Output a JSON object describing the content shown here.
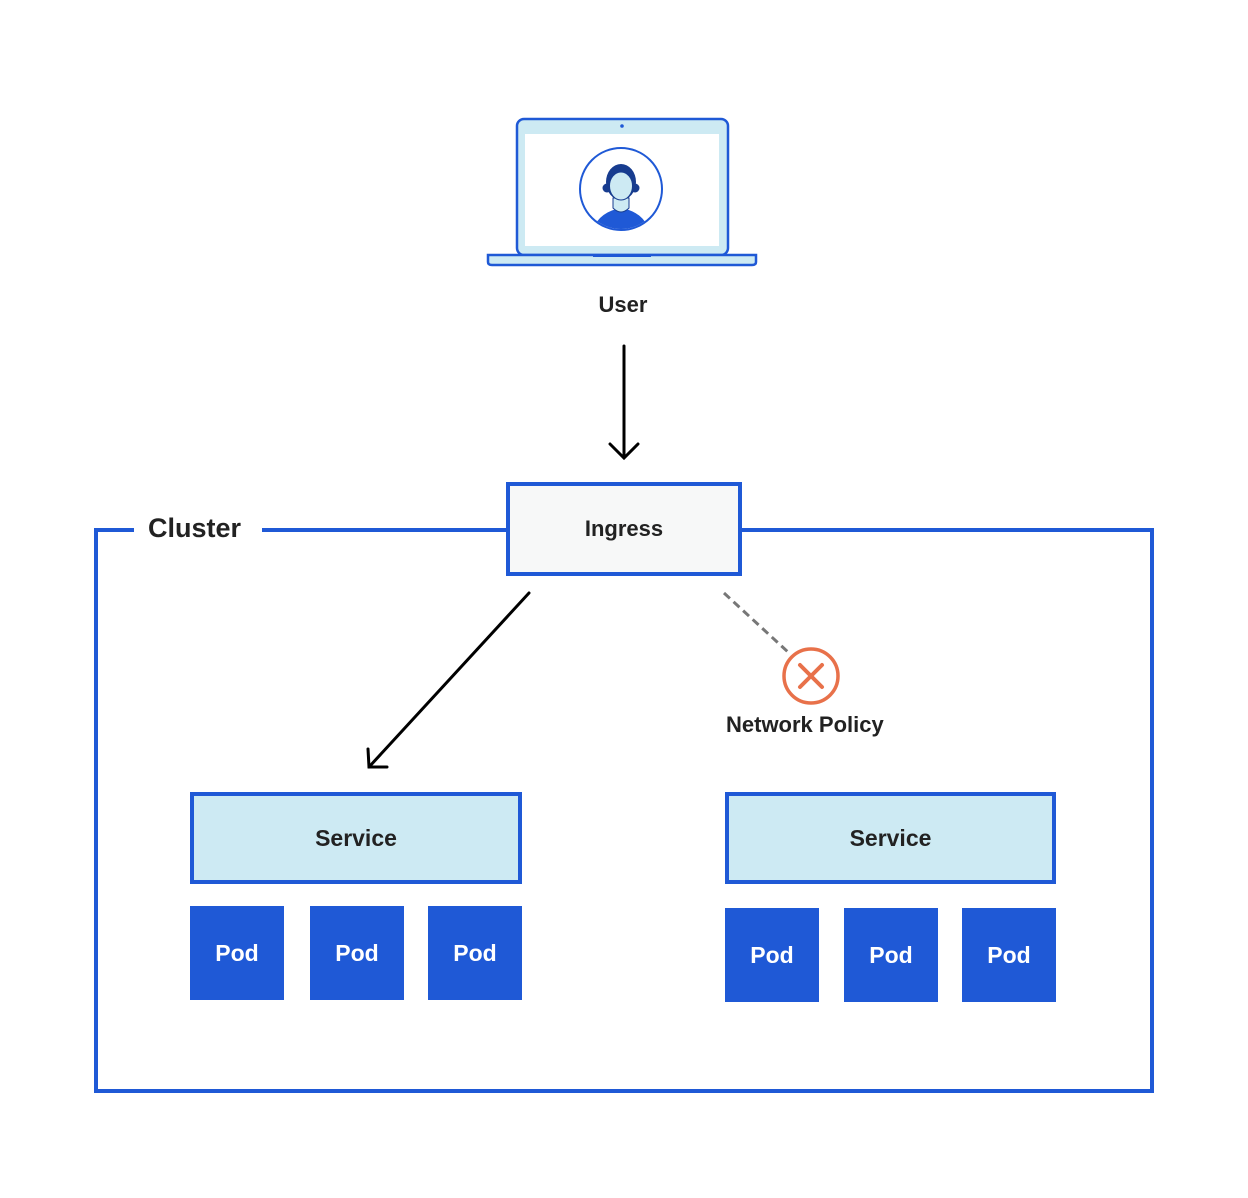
{
  "diagram": {
    "user": {
      "label": "User",
      "icon": "laptop-user-icon"
    },
    "ingress": {
      "label": "Ingress"
    },
    "cluster": {
      "label": "Cluster"
    },
    "network_policy": {
      "label": "Network Policy",
      "icon": "blocked-x-icon"
    },
    "services": [
      {
        "label": "Service",
        "status": "reachable",
        "pods": [
          "Pod",
          "Pod",
          "Pod"
        ]
      },
      {
        "label": "Service",
        "status": "blocked",
        "pods": [
          "Pod",
          "Pod",
          "Pod"
        ]
      }
    ],
    "colors": {
      "primary": "#1f59d6",
      "service_fill": "#cdeaf3",
      "ingress_fill": "#f7f8f8",
      "blocked": "#e8714a",
      "dashed_line": "#777777",
      "text": "#222222"
    }
  }
}
